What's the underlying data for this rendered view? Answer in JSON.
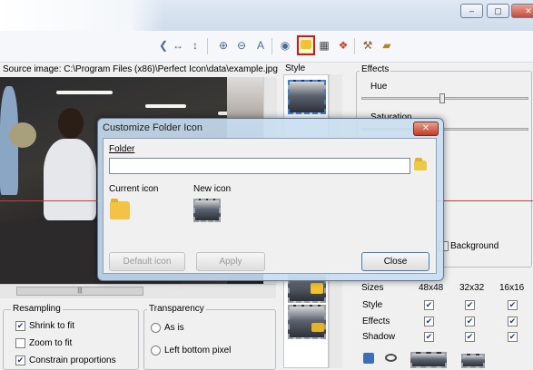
{
  "toolbar": {
    "icons": [
      "rotate-left-icon",
      "arrows-horizontal-icon",
      "zoom-in-icon",
      "zoom-out-icon",
      "zoom-text-icon",
      "eye-icon",
      "favorite-folder-icon",
      "exe-icon",
      "windows-icon",
      "tools-icon",
      "book-icon"
    ]
  },
  "source": {
    "label": "Source image: C:\\Program Files (x86)\\Perfect Icon\\data\\example.jpg",
    "scroll_thumb": "|||"
  },
  "resampling": {
    "title": "Resampling",
    "options": [
      {
        "label": "Shrink to fit",
        "checked": true
      },
      {
        "label": "Zoom to fit",
        "checked": false
      },
      {
        "label": "Constrain proportions",
        "checked": true
      }
    ]
  },
  "transparency": {
    "title": "Transparency",
    "options": [
      "As is",
      "Left bottom pixel"
    ]
  },
  "style": {
    "title": "Style"
  },
  "effects": {
    "title": "Effects",
    "hue_label": "Hue",
    "saturation_label": "Saturation",
    "background_label": "Background",
    "hue_level": 0.5,
    "saturation_level": 0.5
  },
  "sizes": {
    "label": "Sizes",
    "columns": [
      "48x48",
      "32x32",
      "16x16"
    ],
    "rows": [
      {
        "label": "Style",
        "checks": [
          true,
          true,
          true
        ]
      },
      {
        "label": "Effects",
        "checks": [
          true,
          true,
          true
        ]
      },
      {
        "label": "Shadow",
        "checks": [
          true,
          true,
          true
        ]
      }
    ]
  },
  "dialog": {
    "title": "Customize Folder Icon",
    "close_glyph": "✕",
    "folder_label": "Folder",
    "folder_value": "",
    "current_icon_label": "Current icon",
    "new_icon_label": "New icon",
    "default_icon_button": "Default icon",
    "apply_button": "Apply",
    "close_button": "Close"
  },
  "colors": {
    "highlight_border": "#d8141a",
    "dialog_frame": "#c8def2",
    "folder_yellow": "#f3c346"
  }
}
